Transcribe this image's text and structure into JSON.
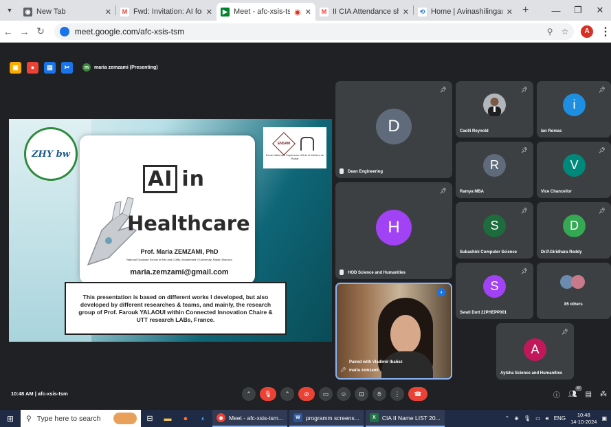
{
  "browser": {
    "tabs": [
      {
        "title": "New Tab",
        "favicon": "chrome-icon",
        "color": "#5f6368"
      },
      {
        "title": "Fwd: Invitation: AI for Engine",
        "favicon": "gmail-icon",
        "color": "#ea4335"
      },
      {
        "title": "Meet - afc-xsis-tsm",
        "favicon": "meet-icon",
        "color": "#00832d",
        "active": true
      },
      {
        "title": "II CIA Attendance sheet - ta",
        "favicon": "gmail-icon",
        "color": "#ea4335"
      },
      {
        "title": "Home | Avinashilingam Insti",
        "favicon": "site-icon",
        "color": "#1a73e8"
      }
    ],
    "new_tab_label": "+",
    "url": "meet.google.com/afc-xsis-tsm",
    "profile_initial": "A"
  },
  "meet": {
    "presenter_label": "maria zemzami (Presenting)",
    "presenter_initial": "m",
    "meeting_info": "10:48 AM  |  afc-xsis-tsm",
    "people_count": "87"
  },
  "slide": {
    "logo_text": "ZHY bw",
    "ai_word": "AI",
    "in_word": "in",
    "title2": "Healthcare",
    "author": "Prof. Maria ZEMZAMI, PhD",
    "affiliation": "National Graduate School of Arts and Crafts, Mohammed V University, Rabat, Morocco",
    "email": "maria.zemzami@gmail.com",
    "ensam_badge": "ENSAM",
    "ensam_caption": "Ecole Nationale Supérieure d'Arts et Métiers de Rabat",
    "description": "This presentation is based on different works I developed, but also developed by different researches & teams, and mainly, the research group of Prof. Farouk YALAOUI within Connected Innovation Chaire & UTT research LABs, France."
  },
  "participants": [
    {
      "name": "Dean Engineering",
      "initial": "D",
      "color": "#5f6b7a"
    },
    {
      "name": "Caolli Reynold",
      "initial": "",
      "color": "#3c4043",
      "photo": true
    },
    {
      "name": "Ian Romas",
      "initial": "i",
      "color": "#1e8fe0"
    },
    {
      "name": "Ramya MBA",
      "initial": "R",
      "color": "#5f6b7a"
    },
    {
      "name": "Vice Chancellor",
      "initial": "V",
      "color": "#00897b"
    },
    {
      "name": "HOD Science and Humanities",
      "initial": "H",
      "color": "#a142f4"
    },
    {
      "name": "Subashini Computer Science",
      "initial": "S",
      "color": "#1e6b3e"
    },
    {
      "name": "Dr.P.Giridhara Reddy",
      "initial": "D",
      "color": "#34a853"
    },
    {
      "name": "Swati Dutt 22PHEPP001",
      "initial": "S",
      "color": "#a142f4"
    },
    {
      "name": "85 others",
      "initial": "",
      "color": "#3c4043"
    },
    {
      "name": "Aylsha Science and Humanities",
      "initial": "A",
      "color": "#c2185b"
    }
  ],
  "self_view": {
    "paired_text": "Paired with Vladimir Ibañez",
    "name": "maria zemzami"
  },
  "taskbar": {
    "search_placeholder": "Type here to search",
    "apps": [
      {
        "label": "Meet - afc-xsis-tsm...",
        "icon": "chrome-icon",
        "color": "#ea4335"
      },
      {
        "label": "programm screens...",
        "icon": "word-icon",
        "color": "#2b579a"
      },
      {
        "label": "CIA II Name LIST 20...",
        "icon": "excel-icon",
        "color": "#217346"
      }
    ],
    "language": "ENG",
    "time": "10:48",
    "date": "14-10-2024"
  }
}
